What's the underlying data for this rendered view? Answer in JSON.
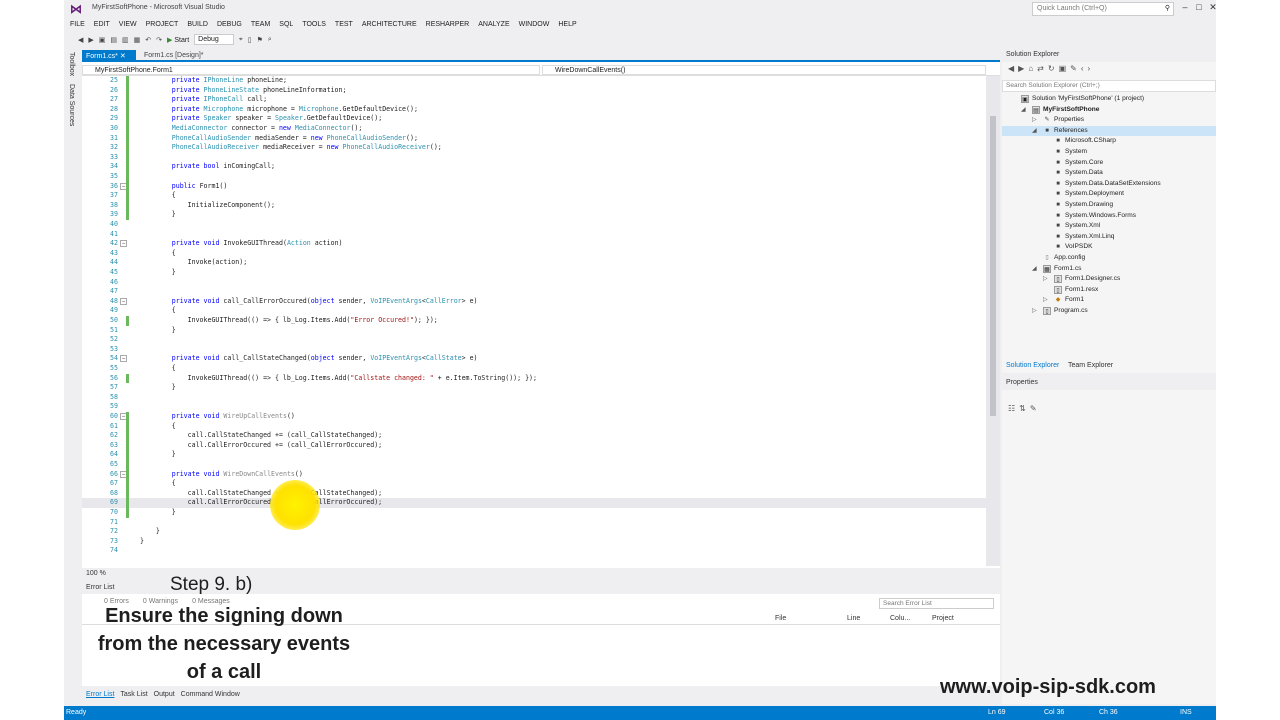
{
  "window": {
    "title": "MyFirstSoftPhone - Microsoft Visual Studio",
    "quick_launch": "Quick Launch (Ctrl+Q)",
    "controls": [
      "–",
      "□",
      "✕"
    ]
  },
  "menu": [
    "FILE",
    "EDIT",
    "VIEW",
    "PROJECT",
    "BUILD",
    "DEBUG",
    "TEAM",
    "SQL",
    "TOOLS",
    "TEST",
    "ARCHITECTURE",
    "RESHARPER",
    "ANALYZE",
    "WINDOW",
    "HELP"
  ],
  "toolbar": {
    "start": "Start",
    "config": "Debug"
  },
  "left_tabs": [
    "Toolbox",
    "Data Sources"
  ],
  "doc_tabs": [
    {
      "label": "Form1.cs*",
      "active": true
    },
    {
      "label": "Form1.cs [Design]*",
      "active": false
    }
  ],
  "nav": {
    "left": "MyFirstSoftPhone.Form1",
    "right": "WireDownCallEvents()"
  },
  "code_lines": [
    {
      "n": "25",
      "t": "        private IPhoneLine phoneLine;"
    },
    {
      "n": "26",
      "t": "        private PhoneLineState phoneLineInformation;"
    },
    {
      "n": "27",
      "t": "        private IPhoneCall call;"
    },
    {
      "n": "28",
      "t": "        private Microphone microphone = Microphone.GetDefaultDevice();"
    },
    {
      "n": "29",
      "t": "        private Speaker speaker = Speaker.GetDefaultDevice();"
    },
    {
      "n": "30",
      "t": "        MediaConnector connector = new MediaConnector();"
    },
    {
      "n": "31",
      "t": "        PhoneCallAudioSender mediaSender = new PhoneCallAudioSender();"
    },
    {
      "n": "32",
      "t": "        PhoneCallAudioReceiver mediaReceiver = new PhoneCallAudioReceiver();"
    },
    {
      "n": "33",
      "t": ""
    },
    {
      "n": "34",
      "t": "        private bool inComingCall;"
    },
    {
      "n": "35",
      "t": ""
    },
    {
      "n": "36",
      "t": "        public Form1()"
    },
    {
      "n": "37",
      "t": "        {"
    },
    {
      "n": "38",
      "t": "            InitializeComponent();"
    },
    {
      "n": "39",
      "t": "        }"
    },
    {
      "n": "40",
      "t": ""
    },
    {
      "n": "41",
      "t": ""
    },
    {
      "n": "42",
      "t": "        private void InvokeGUIThread(Action action)"
    },
    {
      "n": "43",
      "t": "        {"
    },
    {
      "n": "44",
      "t": "            Invoke(action);"
    },
    {
      "n": "45",
      "t": "        }"
    },
    {
      "n": "46",
      "t": ""
    },
    {
      "n": "47",
      "t": ""
    },
    {
      "n": "48",
      "t": "        private void call_CallErrorOccured(object sender, VoIPEventArgs<CallError> e)"
    },
    {
      "n": "49",
      "t": "        {"
    },
    {
      "n": "50",
      "t": "            InvokeGUIThread(() => { lb_Log.Items.Add(\"Error Occured!\"); });"
    },
    {
      "n": "51",
      "t": "        }"
    },
    {
      "n": "52",
      "t": ""
    },
    {
      "n": "53",
      "t": ""
    },
    {
      "n": "54",
      "t": "        private void call_CallStateChanged(object sender, VoIPEventArgs<CallState> e)"
    },
    {
      "n": "55",
      "t": "        {"
    },
    {
      "n": "56",
      "t": "            InvokeGUIThread(() => { lb_Log.Items.Add(\"Callstate changed: \" + e.Item.ToString()); });"
    },
    {
      "n": "57",
      "t": "        }"
    },
    {
      "n": "58",
      "t": ""
    },
    {
      "n": "59",
      "t": ""
    },
    {
      "n": "60",
      "t": "        private void WireUpCallEvents()"
    },
    {
      "n": "61",
      "t": "        {"
    },
    {
      "n": "62",
      "t": "            call.CallStateChanged += (call_CallStateChanged);"
    },
    {
      "n": "63",
      "t": "            call.CallErrorOccured += (call_CallErrorOccured);"
    },
    {
      "n": "64",
      "t": "        }"
    },
    {
      "n": "65",
      "t": ""
    },
    {
      "n": "66",
      "t": "        private void WireDownCallEvents()"
    },
    {
      "n": "67",
      "t": "        {"
    },
    {
      "n": "68",
      "t": "            call.CallStateChanged -= (call_CallStateChanged);"
    },
    {
      "n": "69",
      "t": "            call.CallErrorOccured -= (call_CallErrorOccured);"
    },
    {
      "n": "70",
      "t": "        }"
    },
    {
      "n": "71",
      "t": ""
    },
    {
      "n": "72",
      "t": "    }"
    },
    {
      "n": "73",
      "t": "}"
    },
    {
      "n": "74",
      "t": ""
    }
  ],
  "zoom": "100 %",
  "error_list": {
    "title": "Error List",
    "filters": [
      "0 Errors",
      "0 Warnings",
      "0 Messages"
    ],
    "search": "Search Error List",
    "columns": [
      "File",
      "Line",
      "Colu...",
      "Project"
    ]
  },
  "bottom_tabs": [
    "Error List",
    "Task List",
    "Output",
    "Command Window"
  ],
  "status": {
    "left": "Ready",
    "ln": "Ln 69",
    "col": "Col 36",
    "ch": "Ch 36",
    "ins": "INS"
  },
  "solution_explorer": {
    "title": "Solution Explorer",
    "search": "Search Solution Explorer (Ctrl+;)",
    "tree": [
      {
        "label": "Solution 'MyFirstSoftPhone' (1 project)",
        "indent": 0,
        "icon": "solution-icon",
        "arrow": ""
      },
      {
        "label": "MyFirstSoftPhone",
        "indent": 1,
        "icon": "project-icon",
        "arrow": "◢",
        "bold": true
      },
      {
        "label": "Properties",
        "indent": 2,
        "icon": "wrench-icon",
        "arrow": "▷"
      },
      {
        "label": "References",
        "indent": 2,
        "icon": "references-icon",
        "arrow": "◢",
        "selected": true
      },
      {
        "label": "Microsoft.CSharp",
        "indent": 3,
        "icon": "reference-icon",
        "arrow": ""
      },
      {
        "label": "System",
        "indent": 3,
        "icon": "reference-icon",
        "arrow": ""
      },
      {
        "label": "System.Core",
        "indent": 3,
        "icon": "reference-icon",
        "arrow": ""
      },
      {
        "label": "System.Data",
        "indent": 3,
        "icon": "reference-icon",
        "arrow": ""
      },
      {
        "label": "System.Data.DataSetExtensions",
        "indent": 3,
        "icon": "reference-icon",
        "arrow": ""
      },
      {
        "label": "System.Deployment",
        "indent": 3,
        "icon": "reference-icon",
        "arrow": ""
      },
      {
        "label": "System.Drawing",
        "indent": 3,
        "icon": "reference-icon",
        "arrow": ""
      },
      {
        "label": "System.Windows.Forms",
        "indent": 3,
        "icon": "reference-icon",
        "arrow": ""
      },
      {
        "label": "System.Xml",
        "indent": 3,
        "icon": "reference-icon",
        "arrow": ""
      },
      {
        "label": "System.Xml.Linq",
        "indent": 3,
        "icon": "reference-icon",
        "arrow": ""
      },
      {
        "label": "VoIPSDK",
        "indent": 3,
        "icon": "reference-icon",
        "arrow": ""
      },
      {
        "label": "App.config",
        "indent": 2,
        "icon": "config-icon",
        "arrow": ""
      },
      {
        "label": "Form1.cs",
        "indent": 2,
        "icon": "form-icon",
        "arrow": "◢"
      },
      {
        "label": "Form1.Designer.cs",
        "indent": 3,
        "icon": "csharp-file-icon",
        "arrow": "▷"
      },
      {
        "label": "Form1.resx",
        "indent": 3,
        "icon": "resx-icon",
        "arrow": ""
      },
      {
        "label": "Form1",
        "indent": 3,
        "icon": "class-icon",
        "arrow": "▷"
      },
      {
        "label": "Program.cs",
        "indent": 2,
        "icon": "csharp-file-icon",
        "arrow": "▷"
      }
    ],
    "tabs": [
      "Solution Explorer",
      "Team Explorer"
    ]
  },
  "properties": {
    "title": "Properties"
  },
  "overlay": {
    "step": "Step 9. b)",
    "lines": [
      "Ensure the signing down",
      "from the necessary events",
      "of a call"
    ],
    "site": "www.voip-sip-sdk.com"
  }
}
